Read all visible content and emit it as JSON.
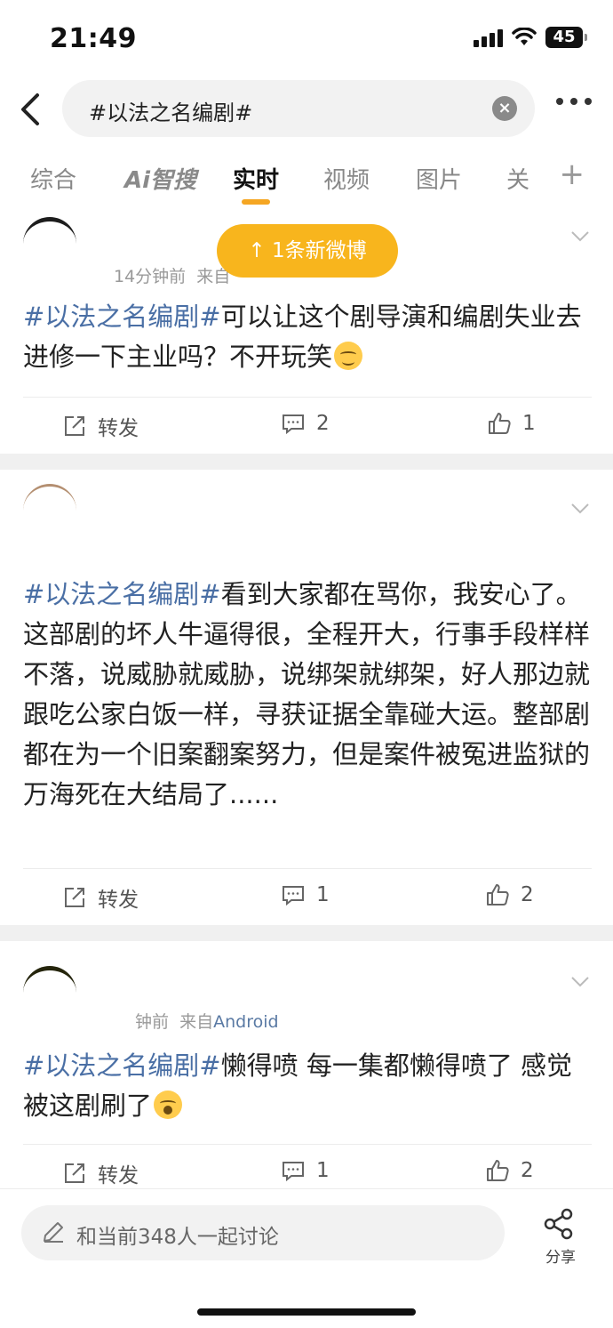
{
  "status": {
    "time": "21:49",
    "battery": "45"
  },
  "search": {
    "query": "#以法之名编剧#"
  },
  "tabs": [
    "综合",
    "Ai智搜",
    "实时",
    "视频",
    "图片",
    "关"
  ],
  "toast": "↑ 1条新微博",
  "posts": [
    {
      "meta_time": "14分钟前",
      "meta_from": "来自",
      "hashtag": "#以法之名编剧#",
      "text": "可以让这个剧导演和编剧失业去进修一下主业吗？不开玩笑",
      "repost": "转发",
      "comments": "2",
      "likes": "1"
    },
    {
      "hashtag": "#以法之名编剧#",
      "text": "看到大家都在骂你，我安心了。这部剧的坏人牛逼得很，全程开大，行事手段样样不落，说威胁就威胁，说绑架就绑架，好人那边就跟吃公家白饭一样，寻获证据全靠碰大运。整部剧都在为一个旧案翻案努力，但是案件被冤进监狱的万海死在大结局了......",
      "repost": "转发",
      "comments": "1",
      "likes": "2"
    },
    {
      "meta_time": "钟前",
      "meta_from": "来自",
      "meta_source": "Android",
      "hashtag": "#以法之名编剧#",
      "text": "懒得喷 每一集都懒得喷了 感觉被这剧刷了",
      "repost": "转发",
      "comments": "1",
      "likes": "2"
    }
  ],
  "bottom": {
    "comment_placeholder": "和当前348人一起讨论",
    "share_label": "分享"
  },
  "colors": {
    "accent": "#f5a623",
    "hashtag": "#4a6fa5",
    "toast": "#f8b51d"
  },
  "icons": [
    "back-arrow-icon",
    "clear-icon",
    "more-icon",
    "plus-icon",
    "chevron-down-icon",
    "repost-icon",
    "comment-icon",
    "like-icon",
    "pencil-icon",
    "share-icon"
  ]
}
